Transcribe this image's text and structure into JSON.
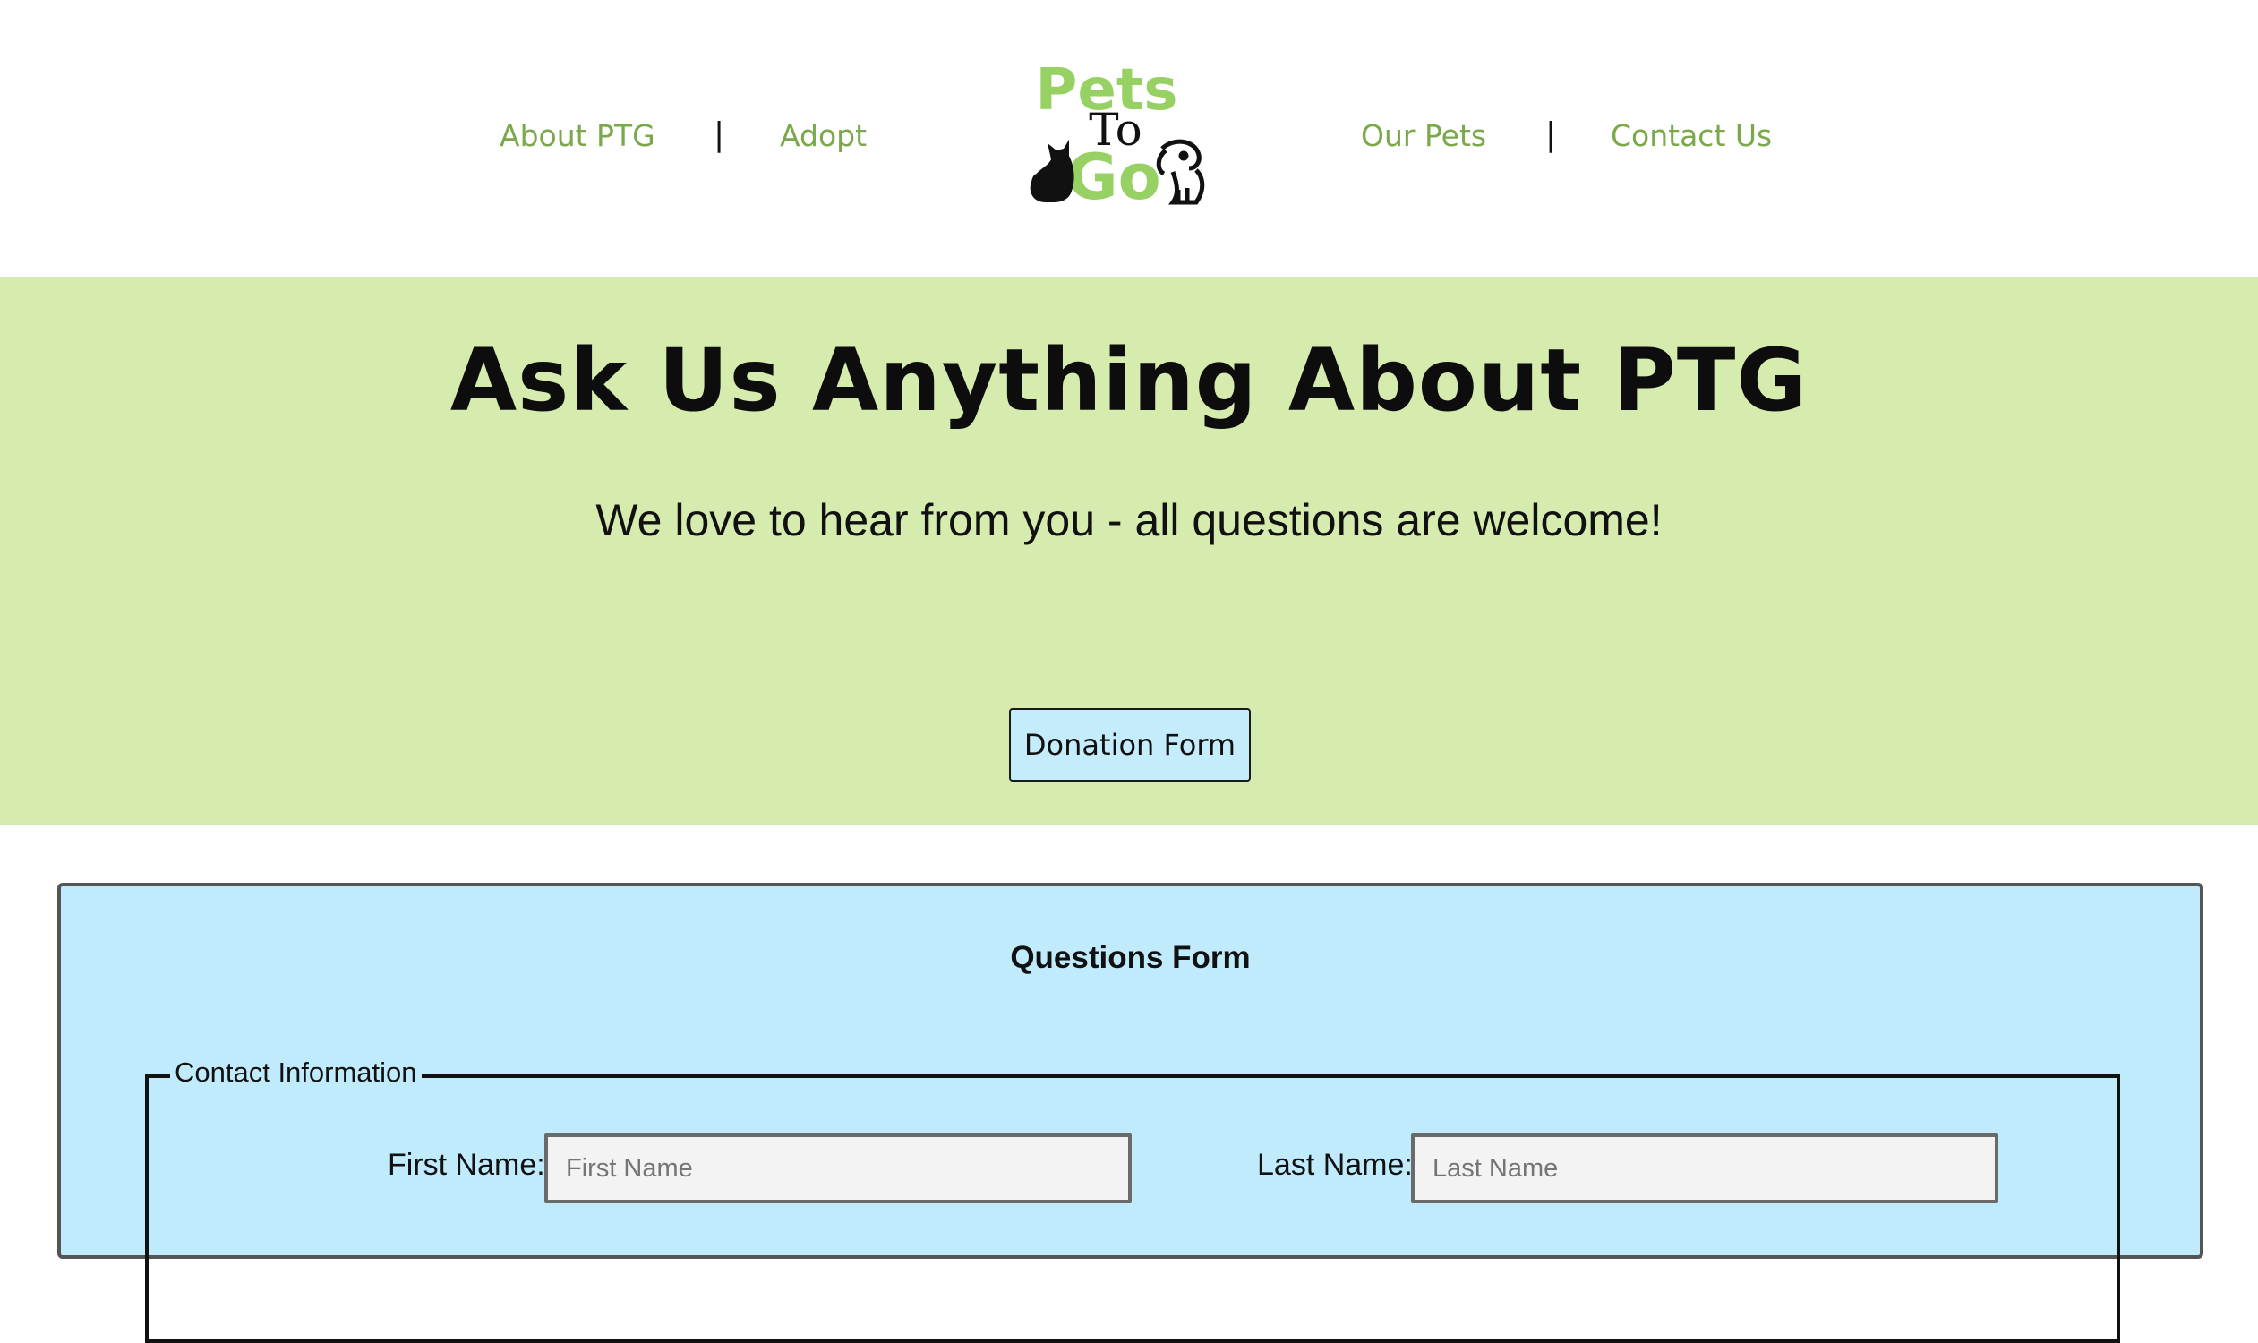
{
  "nav": {
    "left_links": [
      "About PTG",
      "Adopt"
    ],
    "right_links": [
      "Our Pets",
      "Contact Us"
    ],
    "separator": "|"
  },
  "logo": {
    "word_top": "Pets",
    "word_middle": "To",
    "word_bottom": "Go",
    "icons": [
      "cat-icon",
      "dog-icon"
    ],
    "colors": {
      "green": "#97d163",
      "black": "#111111"
    }
  },
  "hero": {
    "title": "Ask Us Anything About PTG",
    "subtitle": "We love to hear from you - all questions are welcome!",
    "button_label": "Donation Form",
    "background": "#d5ecae"
  },
  "form": {
    "title": "Questions Form",
    "background": "#bfebfc",
    "fieldset_legend": "Contact Information",
    "first_name": {
      "label": "First Name:",
      "placeholder": "First Name",
      "value": ""
    },
    "last_name": {
      "label": "Last Name:",
      "placeholder": "Last Name",
      "value": ""
    }
  },
  "colors": {
    "nav_link": "#7aa84a",
    "button_bg": "#c4ecfb"
  }
}
